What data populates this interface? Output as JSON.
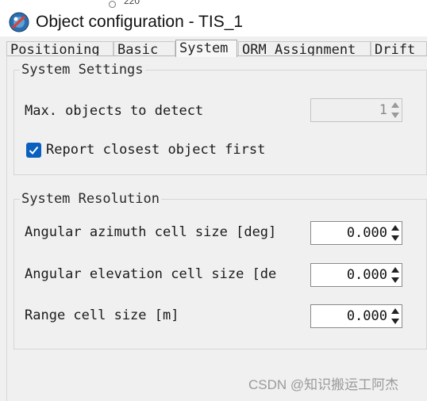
{
  "background_window": {
    "value_text": "220"
  },
  "window": {
    "title": "Object configuration - TIS_1"
  },
  "tabs": [
    {
      "label": "Positioning"
    },
    {
      "label": "Basic"
    },
    {
      "label": "System",
      "active": true
    },
    {
      "label": "ORM Assignment"
    },
    {
      "label": "Drift"
    }
  ],
  "system_settings": {
    "title": "System Settings",
    "max_objects_label": "Max. objects to detect",
    "max_objects_value": "1",
    "max_objects_enabled": false,
    "report_closest_label": "Report closest object first",
    "report_closest_checked": true
  },
  "system_resolution": {
    "title": "System Resolution",
    "azimuth_label": "Angular azimuth cell size [deg]",
    "azimuth_value": "0.000",
    "elevation_label": "Angular elevation cell size [de",
    "elevation_value": "0.000",
    "range_label": "Range cell size [m]",
    "range_value": "0.000"
  },
  "watermark": "CSDN @知识搬运工阿杰",
  "colors": {
    "checkbox_accent": "#0a5fbf",
    "panel_bg": "#f0f0f0"
  }
}
